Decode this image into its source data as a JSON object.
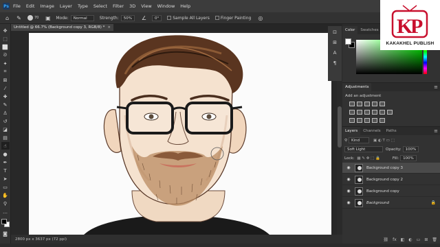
{
  "menubar": {
    "app_icon": "Ps",
    "items": [
      "File",
      "Edit",
      "Image",
      "Layer",
      "Type",
      "Select",
      "Filter",
      "3D",
      "View",
      "Window",
      "Help"
    ]
  },
  "options": {
    "brush_size": "70",
    "mode_label": "Mode:",
    "mode_value": "Normal",
    "strength_label": "Strength:",
    "strength_value": "50%",
    "angle_value": "0°",
    "sample_all_layers": "Sample All Layers",
    "finger_painting": "Finger Painting"
  },
  "document": {
    "tab_title": "Untitled @ 66.7% (Background copy 3, RGB/8) *",
    "status": "2800 px x 3637 px (72 ppi)"
  },
  "color_panel": {
    "tabs": [
      "Color",
      "Swatches"
    ],
    "foreground": "#ffffff",
    "background": "#000000",
    "hue_color": "#00ff00"
  },
  "adjustments": {
    "title": "Adjustments",
    "subtitle": "Add an adjustment"
  },
  "layers_panel": {
    "tabs": [
      "Layers",
      "Channels",
      "Paths"
    ],
    "filter_value": "Kind",
    "blend_mode": "Soft Light",
    "opacity_label": "Opacity:",
    "opacity_value": "100%",
    "lock_label": "Lock:",
    "fill_label": "Fill:",
    "fill_value": "100%",
    "layers": [
      {
        "name": "Background copy 3",
        "selected": true
      },
      {
        "name": "Background copy 2",
        "selected": false
      },
      {
        "name": "Background copy",
        "selected": false
      },
      {
        "name": "Background",
        "selected": false
      }
    ]
  },
  "brand": {
    "logo_letters": "KP",
    "name": "KAKAKHEL PUBLISH",
    "accent": "#c8102e"
  },
  "icons": {
    "toolbar": [
      "move-icon",
      "artboard-icon",
      "marquee-icon",
      "lasso-icon",
      "quick-select-icon",
      "crop-icon",
      "frame-icon",
      "eyedropper-icon",
      "healing-icon",
      "brush-icon",
      "stamp-icon",
      "history-brush-icon",
      "eraser-icon",
      "gradient-icon",
      "smudge-icon",
      "dodge-icon",
      "pen-icon",
      "type-icon",
      "path-select-icon",
      "shape-icon",
      "hand-icon",
      "zoom-icon"
    ]
  }
}
